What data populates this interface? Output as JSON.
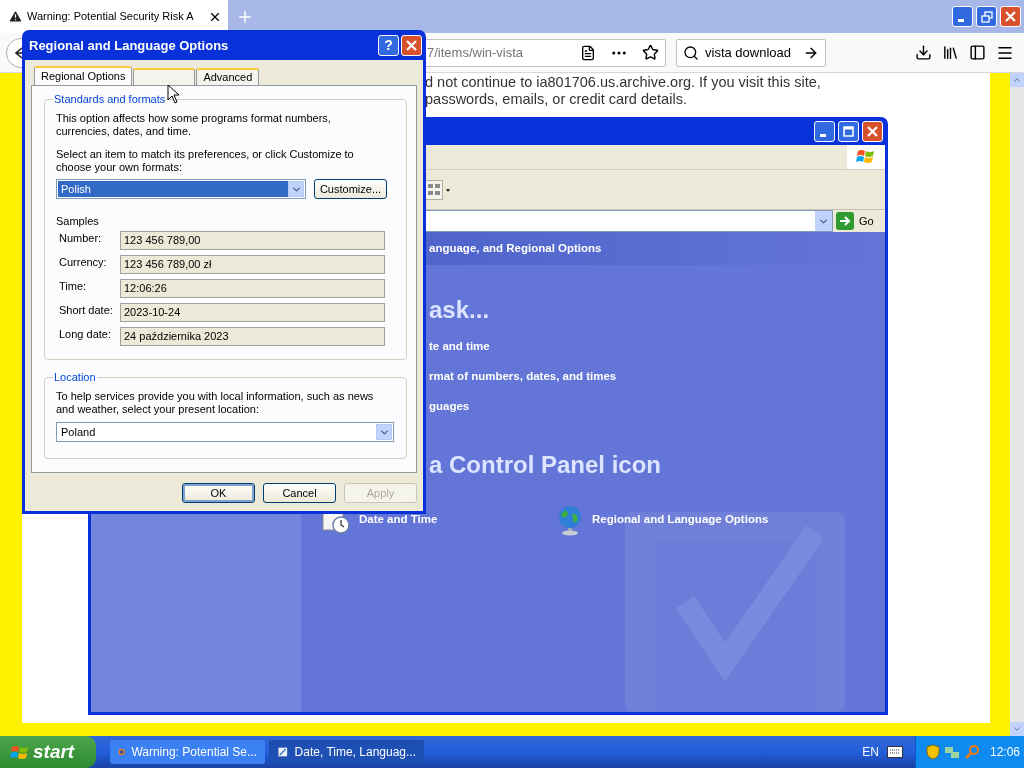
{
  "browser": {
    "tabs": [
      {
        "title": "Warning: Potential Security Risk A",
        "selected": true
      }
    ],
    "url": "7/items/win-vista",
    "search": "vista download",
    "page_text": [
      "d not continue to ia801706.us.archive.org. If you visit this site,",
      "passwords, emails, or credit card details."
    ]
  },
  "control_panel": {
    "go_label": "Go",
    "header": "anguage, and Regional Options",
    "task_heading": "ask...",
    "tasks": [
      "te and time",
      "rmat of numbers, dates, and times",
      "guages"
    ],
    "icon_heading": "a Control Panel icon",
    "icons": [
      {
        "label": "Date and Time",
        "kind": "clock"
      },
      {
        "label": "Regional and Language Options",
        "kind": "globe"
      }
    ]
  },
  "dialog": {
    "title": "Regional and Language Options",
    "help_glyph": "?",
    "tabs": [
      {
        "label": "Regional Options",
        "selected": true
      },
      {
        "selected": false
      },
      {
        "label": "Advanced",
        "selected": false
      }
    ],
    "standards": {
      "legend": "Standards and formats",
      "description": "This option affects how some programs format numbers, currencies, dates, and time.",
      "instruction": "Select an item to match its preferences, or click Customize to choose your own formats:",
      "format": "Polish",
      "format_highlighted": true,
      "customize": "Customize...",
      "samples_label": "Samples",
      "samples": [
        {
          "label": "Number:",
          "value": "123 456 789,00"
        },
        {
          "label": "Currency:",
          "value": "123 456 789,00 zł"
        },
        {
          "label": "Time:",
          "value": "12:06:26"
        },
        {
          "label": "Short date:",
          "value": "2023-10-24"
        },
        {
          "label": "Long date:",
          "value": "24 października 2023"
        }
      ]
    },
    "location": {
      "legend": "Location",
      "description": "To help services provide you with local information, such as news and weather, select your present location:",
      "value": "Poland",
      "highlighted": false
    },
    "buttons": [
      {
        "label": "OK",
        "default": true,
        "disabled": false
      },
      {
        "label": "Cancel",
        "default": false,
        "disabled": false
      },
      {
        "label": "Apply",
        "default": false,
        "disabled": true
      }
    ]
  },
  "taskbar": {
    "start": "start",
    "tasks": [
      {
        "label": "Warning: Potential Se...",
        "selected": false,
        "kind": "browser"
      },
      {
        "label": "Date, Time, Languag...",
        "selected": true,
        "kind": "panel"
      }
    ],
    "language": "EN",
    "clock": "12:06"
  }
}
